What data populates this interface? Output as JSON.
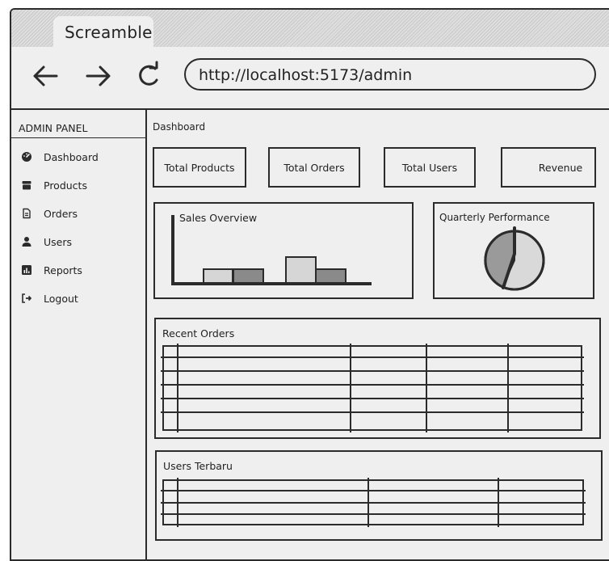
{
  "browser": {
    "tab_title": "Screamble",
    "url": "http://localhost:5173/admin"
  },
  "sidebar": {
    "title": "ADMIN PANEL",
    "items": [
      {
        "label": "Dashboard",
        "icon": "dashboard-icon"
      },
      {
        "label": "Products",
        "icon": "box-icon"
      },
      {
        "label": "Orders",
        "icon": "document-icon"
      },
      {
        "label": "Users",
        "icon": "user-icon"
      },
      {
        "label": "Reports",
        "icon": "chart-icon"
      },
      {
        "label": "Logout",
        "icon": "logout-icon"
      }
    ]
  },
  "main": {
    "title": "Dashboard",
    "cards": [
      {
        "label": "Total Products"
      },
      {
        "label": "Total Orders"
      },
      {
        "label": "Total Users"
      },
      {
        "label": "Revenue"
      }
    ],
    "sales": {
      "title": "Sales Overview"
    },
    "quarterly": {
      "title": "Quarterly Performance"
    },
    "recent_orders": {
      "title": "Recent Orders"
    },
    "users_latest": {
      "title": "Users Terbaru"
    }
  },
  "colors": {
    "ink": "#2b2b2b",
    "bar_light": "#d6d6d6",
    "bar_dark": "#8a8a8a",
    "pie_light": "#d9d9d9",
    "pie_dark": "#9a9a9a"
  },
  "chart_data": [
    {
      "type": "bar",
      "title": "Sales Overview",
      "categories": [],
      "values": [],
      "note_shades": [
        "light",
        "dark",
        "light",
        "dark"
      ]
    },
    {
      "type": "pie",
      "title": "Quarterly Performance",
      "values": []
    }
  ]
}
